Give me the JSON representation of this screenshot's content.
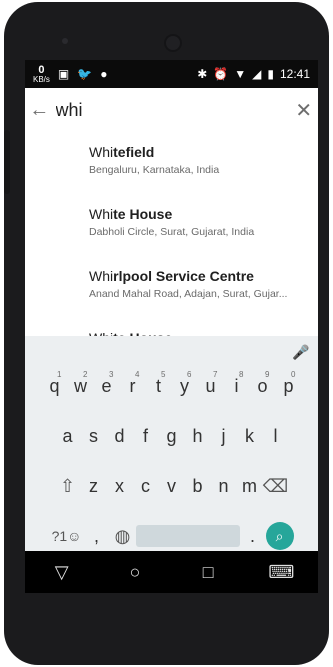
{
  "status": {
    "net_rate_value": "0",
    "net_rate_unit": "KB/s",
    "time": "12:41"
  },
  "search": {
    "query": "whi"
  },
  "results": [
    {
      "match": "Whi",
      "rest": "tefield",
      "subtitle": "Bengaluru, Karnataka, India"
    },
    {
      "match": "Whi",
      "rest": "te House",
      "subtitle": "Dabholi Circle, Surat, Gujarat, India"
    },
    {
      "match": "Whi",
      "rest": "rlpool Service Centre",
      "subtitle": "Anand Mahal Road, Adajan, Surat, Gujar..."
    },
    {
      "match": "Whi",
      "rest": "te House",
      "subtitle": ""
    }
  ],
  "keyboard": {
    "row1": [
      "q",
      "w",
      "e",
      "r",
      "t",
      "y",
      "u",
      "i",
      "o",
      "p"
    ],
    "row1_hints": [
      "1",
      "2",
      "3",
      "4",
      "5",
      "6",
      "7",
      "8",
      "9",
      "0"
    ],
    "row2": [
      "a",
      "s",
      "d",
      "f",
      "g",
      "h",
      "j",
      "k",
      "l"
    ],
    "row3": [
      "z",
      "x",
      "c",
      "v",
      "b",
      "n",
      "m"
    ],
    "symbols_key": "?1☺",
    "comma_key": ",",
    "period_key": "."
  },
  "colors": {
    "accent": "#26a69a",
    "keyboard_bg": "#eceff1"
  }
}
